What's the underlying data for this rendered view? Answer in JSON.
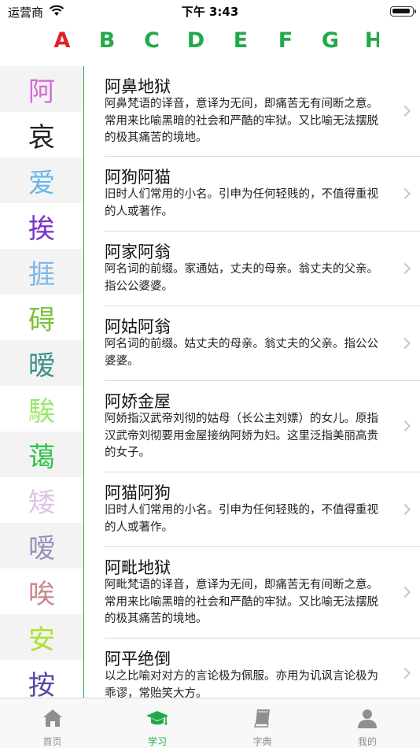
{
  "status_bar": {
    "carrier": "运营商",
    "time": "下午 3:43"
  },
  "alphabet": {
    "letters": [
      "A",
      "B",
      "C",
      "D",
      "E",
      "F",
      "G",
      "H"
    ],
    "active": "A",
    "active_color": "#e02222",
    "inactive_color": "#22a94a"
  },
  "characters": [
    {
      "char": "阿",
      "color": "#d36bd8"
    },
    {
      "char": "哀",
      "color": "#222222"
    },
    {
      "char": "爱",
      "color": "#6ab7e6"
    },
    {
      "char": "挨",
      "color": "#7a2fc9"
    },
    {
      "char": "捱",
      "color": "#7fb8e8"
    },
    {
      "char": "碍",
      "color": "#7cc23a"
    },
    {
      "char": "暧",
      "color": "#3f8f8b"
    },
    {
      "char": "騃",
      "color": "#9be86a"
    },
    {
      "char": "蔼",
      "color": "#2fc34a"
    },
    {
      "char": "矮",
      "color": "#e0c2e8"
    },
    {
      "char": "嗳",
      "color": "#9b8fb9"
    },
    {
      "char": "唉",
      "color": "#c9868a"
    },
    {
      "char": "安",
      "color": "#aee02b"
    },
    {
      "char": "按",
      "color": "#5c47a8"
    }
  ],
  "words": [
    {
      "title": "阿鼻地狱",
      "definition": "阿鼻梵语的译音，意译为无间，即痛苦无有间断之意。常用来比喻黑暗的社会和严酷的牢狱。又比喻无法摆脱的极其痛苦的境地。"
    },
    {
      "title": "阿狗阿猫",
      "definition": "旧时人们常用的小名。引申为任何轻贱的，不值得重视的人或著作。"
    },
    {
      "title": "阿家阿翁",
      "definition": "阿名词的前缀。家通姑，丈夫的母亲。翁丈夫的父亲。指公公婆婆。"
    },
    {
      "title": "阿姑阿翁",
      "definition": "阿名词的前缀。姑丈夫的母亲。翁丈夫的父亲。指公公婆婆。"
    },
    {
      "title": "阿娇金屋",
      "definition": "阿娇指汉武帝刘彻的姑母（长公主刘嫖）的女儿。原指汉武帝刘彻要用金屋接纳阿娇为妇。这里泛指美丽高贵的女子。"
    },
    {
      "title": "阿猫阿狗",
      "definition": "旧时人们常用的小名。引申为任何轻贱的，不值得重视的人或著作。"
    },
    {
      "title": "阿毗地狱",
      "definition": "阿毗梵语的译音，意译为无间，即痛苦无有间断之意。常用来比喻黑暗的社会和严酷的牢狱。又比喻无法摆脱的极其痛苦的境地。"
    },
    {
      "title": "阿平绝倒",
      "definition": "以之比喻对对方的言论极为佩服。亦用为讥讽言论极为乖谬，常贻笑大方。"
    }
  ],
  "tabs": [
    {
      "label": "首页",
      "icon": "home-icon"
    },
    {
      "label": "学习",
      "icon": "graduation-cap-icon"
    },
    {
      "label": "字典",
      "icon": "book-icon"
    },
    {
      "label": "我的",
      "icon": "person-icon"
    }
  ],
  "active_tab": "学习",
  "accent_color": "#22a94a"
}
